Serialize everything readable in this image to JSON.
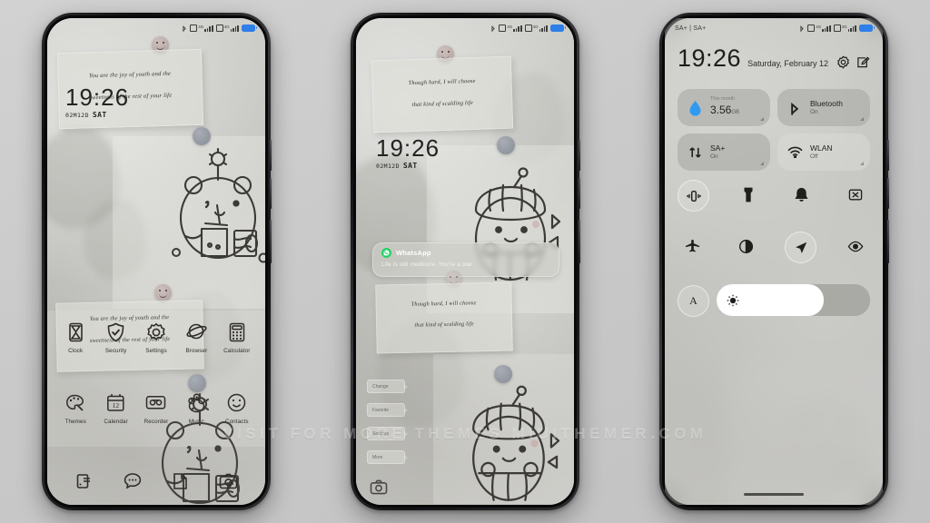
{
  "watermark": "VISIT FOR MORE THEMES MIUITHEMER.COM",
  "phone1": {
    "label": "lockscreen-home",
    "statusbar": {
      "left": "",
      "sim1": "4G",
      "sim2": "4G"
    },
    "note": {
      "line1": "You are the joy of youth and the",
      "line2": "sweetness of the rest of your life"
    },
    "clock": {
      "time": "19:26",
      "date_code": "02M12D",
      "weekday": "SAT"
    },
    "apps_row1": [
      {
        "label": "Clock",
        "icon": "hourglass-icon"
      },
      {
        "label": "Security",
        "icon": "shield-check-icon"
      },
      {
        "label": "Settings",
        "icon": "gear-icon"
      },
      {
        "label": "Browser",
        "icon": "planet-icon"
      },
      {
        "label": "Calculator",
        "icon": "calculator-icon"
      }
    ],
    "apps_row2": [
      {
        "label": "Themes",
        "icon": "palette-icon"
      },
      {
        "label": "Calendar",
        "icon": "calendar-icon"
      },
      {
        "label": "Recorder",
        "icon": "cassette-icon"
      },
      {
        "label": "Music",
        "icon": "flower-bear-icon"
      },
      {
        "label": "Contacts",
        "icon": "smiley-face-icon"
      }
    ],
    "dock": [
      {
        "label": "Phone",
        "icon": "phone-icon"
      },
      {
        "label": "Messages",
        "icon": "chat-bubble-icon"
      },
      {
        "label": "Files",
        "icon": "notes-icon"
      },
      {
        "label": "Camera",
        "icon": "camera-icon"
      }
    ]
  },
  "phone2": {
    "label": "lockscreen",
    "note": {
      "line1": "Though hard, I will choose",
      "line2": "that kind of scalding life"
    },
    "clock": {
      "time": "19:26",
      "date_code": "02M12D",
      "weekday": "SAT"
    },
    "notification": {
      "app": "WhatsApp",
      "message": "Life is still mediocre. You're a star",
      "accent": "#25d366"
    },
    "chips": [
      "Change",
      "Favorite",
      "Settings",
      "More"
    ],
    "camera_shortcut": "camera-icon"
  },
  "phone3": {
    "label": "control-center",
    "statusbar": {
      "carrier": "SA+ | SA+",
      "sim1": "4G",
      "sim2": "4G"
    },
    "header": {
      "time": "19:26",
      "date": "Saturday, February 12"
    },
    "header_icons": [
      "settings-gear-icon",
      "edit-icon"
    ],
    "tiles": [
      {
        "name": "mobile-data-usage",
        "title": "3.56",
        "unit": "GB",
        "sub": "This month",
        "state": "on",
        "icon": "data-drop-icon",
        "accent": "#2e9bf0"
      },
      {
        "name": "bluetooth",
        "title": "Bluetooth",
        "sub": "On",
        "state": "on",
        "icon": "bluetooth-icon"
      },
      {
        "name": "mobile-data",
        "title": "SA+",
        "sub": "On",
        "state": "on",
        "icon": "data-arrows-icon"
      },
      {
        "name": "wlan",
        "title": "WLAN",
        "sub": "Off",
        "state": "off",
        "icon": "wifi-icon"
      }
    ],
    "toggles_row1": [
      {
        "name": "vibrate",
        "icon": "vibrate-icon",
        "active": true
      },
      {
        "name": "flashlight",
        "icon": "flashlight-icon",
        "active": false
      },
      {
        "name": "silent",
        "icon": "bell-icon",
        "active": false
      },
      {
        "name": "screenshot",
        "icon": "screenshot-icon",
        "active": false
      }
    ],
    "toggles_row2": [
      {
        "name": "airplane-mode",
        "icon": "airplane-icon",
        "active": false
      },
      {
        "name": "dark-mode",
        "icon": "contrast-icon",
        "active": false
      },
      {
        "name": "location",
        "icon": "location-arrow-icon",
        "active": true
      },
      {
        "name": "reading-mode",
        "icon": "eye-icon",
        "active": false
      }
    ],
    "brightness": {
      "auto_label": "A",
      "level_percent": 70,
      "icon": "sun-icon"
    }
  }
}
